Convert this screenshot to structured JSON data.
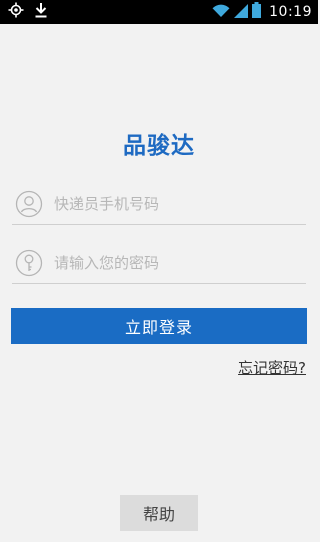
{
  "status_bar": {
    "time": "10:19",
    "icons": [
      "gps-icon",
      "download-icon",
      "wifi-icon",
      "signal-icon",
      "battery-icon"
    ]
  },
  "app": {
    "title": "品骏达"
  },
  "form": {
    "phone_placeholder": "快递员手机号码",
    "phone_value": "",
    "password_placeholder": "请输入您的密码",
    "password_value": "",
    "login_label": "立即登录",
    "forgot_label": "忘记密码?"
  },
  "footer": {
    "help_label": "帮助"
  },
  "colors": {
    "brand": "#1e6ac2",
    "button": "#1a6cc4",
    "background": "#f2f2f2"
  }
}
